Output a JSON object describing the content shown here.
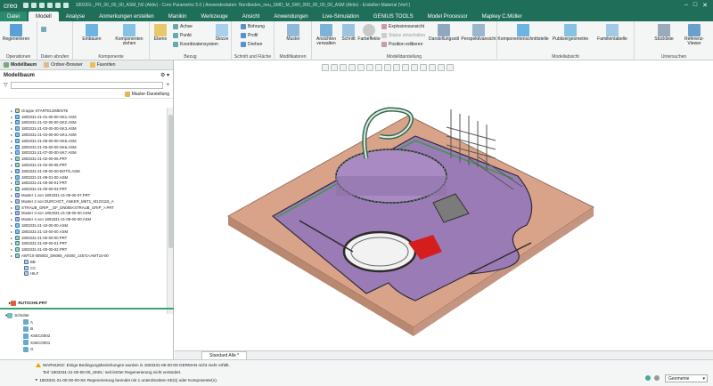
{
  "app": {
    "logo": "creo",
    "title_text": "18033l1-_PR_00_00_00_ASM_N0 (Aktiv) - Creo Parametric 5.0 | Anwenderdaten: Nordboden_neu_SMD_M_SWI_000_00_00_00_ASM (Aktiv) - Erstellen Material (Verf.)"
  },
  "tabs": [
    "Datei",
    "Modell",
    "Analyse",
    "Anmerkungen erstellen",
    "Manikin",
    "Werkzeuge",
    "Ansicht",
    "Anwendungen",
    "Live-Simulation",
    "GENIUS TOOLS",
    "Model Processor",
    "Mapkey C.Müller"
  ],
  "ribbon": {
    "groups": [
      {
        "label": "Operationen",
        "buttons": [
          "Regenerieren"
        ]
      },
      {
        "label": "Daten abrufen",
        "buttons": []
      },
      {
        "label": "Komponente",
        "buttons": [
          "Einbauen",
          "Komponenten ziehen"
        ]
      },
      {
        "label": "Bezug",
        "buttons": [
          "Ebene",
          "Skizze"
        ],
        "small": [
          "Achse",
          "Punkt",
          "Koordinatensystem"
        ]
      },
      {
        "label": "Schnitt und Fläche",
        "small": [
          "Bohrung",
          "Profil",
          "Drehen"
        ]
      },
      {
        "label": "Modifikatoren",
        "buttons": [
          "Muster"
        ]
      },
      {
        "label": "Modelldarstellung",
        "buttons": [
          "Ansichten verwalten",
          "Schnitt",
          "Farbeffekte",
          "Darstellungsstil",
          "Perspektivansicht"
        ],
        "small": [
          "Explosionsansicht",
          "Status umschalten",
          "Position editieren"
        ]
      },
      {
        "label": "Modellabsicht",
        "buttons": [
          "Komponentenschnittstelle",
          "Publizergeometrie",
          "Familientabelle"
        ]
      },
      {
        "label": "Untersuchen",
        "buttons": [
          "Stückliste",
          "Referenz-Viewer"
        ]
      }
    ]
  },
  "panel": {
    "tabs": [
      "Modellbaum",
      "Ordner-Browser",
      "Favoriten"
    ],
    "header": "Modellbaum",
    "column_header": "Master-Darstellung",
    "tree": [
      "Gruppe STARTELEMENTE",
      "1803331-21-01-00-00-SK1.ASM",
      "1803331-21-02-00-00-SK2.ASM",
      "1803331-21-03-00-00-SK3.ASM",
      "1803331-21-04-00-00-SK4.ASM",
      "1803331-21-05-00-00-SK5.ASM",
      "1803331-21-06-00-00-SK6.ASM",
      "1803331-21-07-00-00-SK7.ASM",
      "1803331-21-02-00-05.PRT",
      "1803331-21-02-00-06.PRT",
      "1803331-21-09-00-00-BOTO.ASM",
      "1803331-21-09-01-00.ASM",
      "1803331-21-00-00-01.PRT",
      "1803331-21-00-00-03.PRT",
      "Muster 1 von 1803331-21-09-00-07.PRT",
      "Muster 2 von DURCHGT_ANKER_M6T1_M12X115_A",
      "STRAUB_GRIP__DF_DN065<STRAUB_GRIP_>.PRT",
      "Muster 3 von 1803331-21-08-00-00.ASM",
      "Muster 4 von 1803331-21-08-00-00.ASM",
      "1803331-21-10-00-00.ASM",
      "1803331-21-10-00-00.ASM",
      "1803331-21-00-00-00.PRT",
      "1803331-21-00-00-01.PRT",
      "1803331-21-00-00-02.PRT",
      "AWT10-005002_DN065_A0400_14571<AWT10-00",
      "BB",
      "CC",
      "HILF"
    ],
    "rutsche": "RUTSCHE.PRT",
    "schnitte": {
      "label": "Schnitte",
      "items": [
        "A",
        "B",
        "XSEC0002",
        "XSEC0001",
        "G"
      ]
    }
  },
  "viewport": {
    "tab": "Standard Alle *"
  },
  "status": {
    "messages": [
      "WARNUNG: Einige Bedingungsbeziehungen wurden in 1803331-06-00-00-GERMAN nicht mehr erfüllt.",
      "Teil '1803331-21-00-00-00_SKEL' seit letzter Regenerierung nicht verändert.",
      "1803331-21-00-00-00-SK Regenerierung beendet mit 1 unterdrückten KE(s) oder Komponente(n)."
    ],
    "filter": "Geometrie"
  },
  "colors": {
    "accent": "#1e6e5a",
    "tab_active": "#f4f6f6",
    "pool_violet": "#9b7bb5",
    "floor": "#dba58c"
  }
}
